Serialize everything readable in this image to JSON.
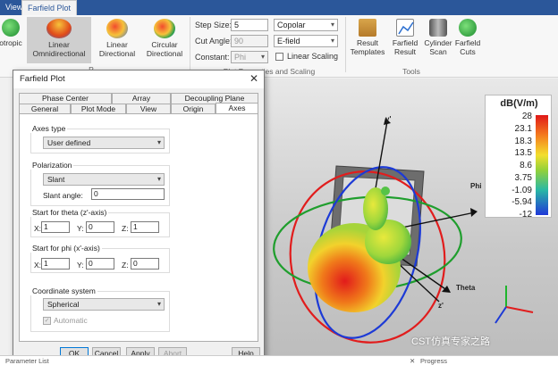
{
  "ribbon_tabs": [
    "View",
    "Farfield Plot"
  ],
  "ribbon": {
    "buttons": [
      {
        "label": "otropic"
      },
      {
        "label": "Linear\nOmnidirectional"
      },
      {
        "label": "Linear\nDirectional"
      },
      {
        "label": "Circular\nDirectional"
      }
    ],
    "step_size_label": "Step Size:",
    "step_size_value": "5",
    "cut_angle_label": "Cut Angle:",
    "cut_angle_value": "90",
    "constant_label": "Constant:",
    "constant_value": "Phi",
    "polarization_value": "Copolar",
    "field_value": "E-field",
    "linear_scaling_label": "Linear Scaling",
    "group_plot_type": "P",
    "group_plot_props": "Plot Properties and Scaling",
    "tools": [
      {
        "label": "Result\nTemplates"
      },
      {
        "label": "Farfield\nResult"
      },
      {
        "label": "Cylinder\nScan"
      },
      {
        "label": "Farfield\nCuts"
      }
    ],
    "group_tools": "Tools"
  },
  "dialog": {
    "title": "Farfield Plot",
    "tabs_row1": [
      "Phase Center",
      "Array",
      "Decoupling Plane"
    ],
    "tabs_row2": [
      "General",
      "Plot Mode",
      "View",
      "Origin",
      "Axes"
    ],
    "axes_type_label": "Axes type",
    "axes_type_value": "User defined",
    "polarization_label": "Polarization",
    "polarization_value": "Slant",
    "slant_angle_label": "Slant angle:",
    "slant_angle_value": "0",
    "theta_label": "Start for theta (z'-axis)",
    "theta_x": "1",
    "theta_y": "0",
    "theta_z": "1",
    "phi_label": "Start for phi (x'-axis)",
    "phi_x": "1",
    "phi_y": "0",
    "phi_z": "0",
    "x_label": "X:",
    "y_label": "Y:",
    "z_label": "Z:",
    "coord_label": "Coordinate system",
    "coord_value": "Spherical",
    "automatic_label": "Automatic",
    "buttons": {
      "ok": "OK",
      "cancel": "Cancel",
      "apply": "Apply",
      "abort": "Abort",
      "help": "Help"
    }
  },
  "legend": {
    "unit": "dB(V/m)",
    "ticks": [
      "28",
      "23.1",
      "18.3",
      "13.5",
      "8.6",
      "3.75",
      "-1.09",
      "-5.94",
      "-12"
    ]
  },
  "viewport": {
    "axis_y": "y'",
    "axis_phi": "Phi",
    "axis_theta": "Theta",
    "axis_z": "z'",
    "watermark": "CST仿真专家之路"
  },
  "status": {
    "left": "Parameter List",
    "right": "Progress"
  }
}
